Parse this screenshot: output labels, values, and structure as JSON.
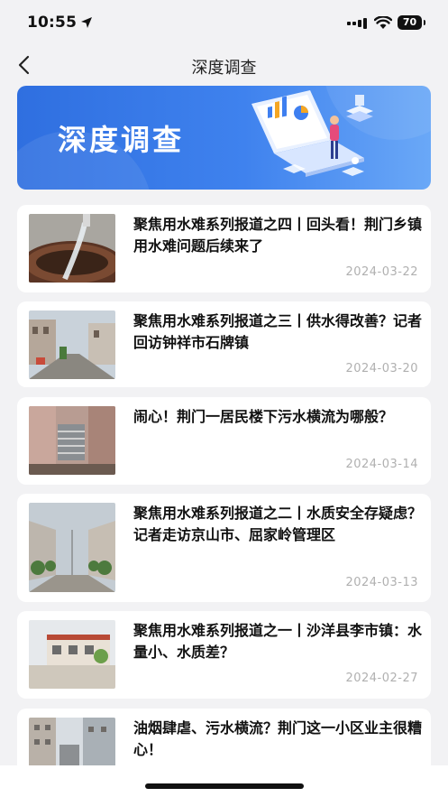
{
  "status": {
    "time": "10:55",
    "battery": "70"
  },
  "nav": {
    "title": "深度调查"
  },
  "banner": {
    "title": "深度调查"
  },
  "articles": [
    {
      "title": "聚焦用水难系列报道之四丨回头看！荆门乡镇用水难问题后续来了",
      "date": "2024-03-22"
    },
    {
      "title": "聚焦用水难系列报道之三丨供水得改善？记者回访钟祥市石牌镇",
      "date": "2024-03-20"
    },
    {
      "title": "闹心！荆门一居民楼下污水横流为哪般？",
      "date": "2024-03-14"
    },
    {
      "title": "聚焦用水难系列报道之二丨水质安全存疑虑？记者走访京山市、屈家岭管理区",
      "date": "2024-03-13"
    },
    {
      "title": "聚焦用水难系列报道之一丨沙洋县李市镇：水量小、水质差？",
      "date": "2024-02-27"
    },
    {
      "title": "油烟肆虐、污水横流？荆门这一小区业主很糟心！",
      "date": ""
    }
  ]
}
